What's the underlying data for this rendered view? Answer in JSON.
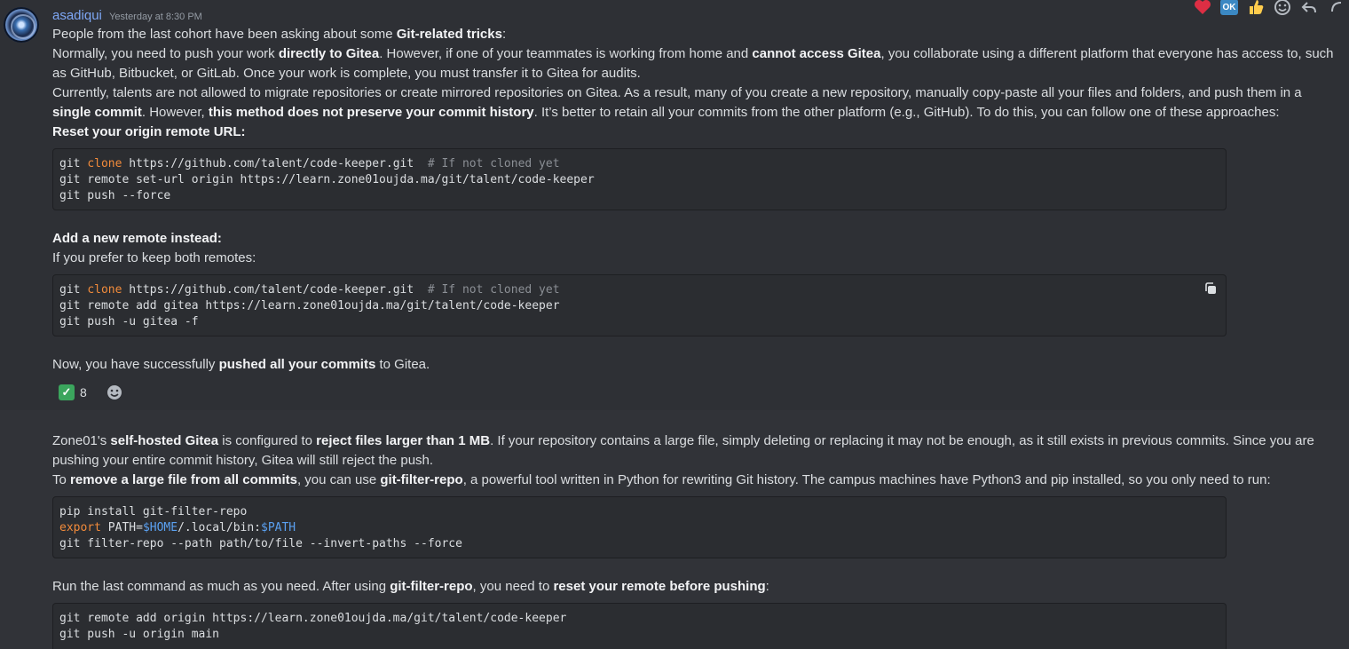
{
  "message1": {
    "username": "asadiqui",
    "timestamp": "Yesterday at 8:30 PM",
    "line1": {
      "a": "People from the last cohort have been asking about some ",
      "b": "Git-related tricks",
      "c": ":"
    },
    "line2": {
      "a": "Normally, you need to push your work ",
      "b": "directly to Gitea",
      "c": ". However, if one of your teammates is working from home and ",
      "d": "cannot access Gitea",
      "e": ", you collaborate using a different platform that everyone has access to, such"
    },
    "line3": "as GitHub, Bitbucket, or GitLab. Once your work is complete, you must transfer it to Gitea for audits.",
    "line4": "Currently, talents are not allowed to migrate repositories or create mirrored repositories on Gitea. As a result, many of you create a new repository, manually copy-paste all your files and folders, and push them in a",
    "line5": {
      "a": "single commit",
      "b": ". However, ",
      "c": "this method does not preserve your commit history",
      "d": ". It’s better to retain all your commits from the other platform (e.g., GitHub). To do this, you can follow one of these approaches:"
    },
    "heading1": "Reset your origin remote URL:",
    "code1": {
      "l1_git": "git ",
      "l1_kw": "clone",
      "l1_rest": " https://github.com/talent/code-keeper.git  ",
      "l1_cmt": "# If not cloned yet",
      "l2": "git remote set-url origin https://learn.zone01oujda.ma/git/talent/code-keeper",
      "l3": "git push --force"
    },
    "heading2": "Add a new remote instead:",
    "line6": "If you prefer to keep both remotes:",
    "code2": {
      "l1_git": "git ",
      "l1_kw": "clone",
      "l1_rest": " https://github.com/talent/code-keeper.git  ",
      "l1_cmt": "# If not cloned yet",
      "l2": "git remote add gitea https://learn.zone01oujda.ma/git/talent/code-keeper",
      "l3": "git push -u gitea -f"
    },
    "line7": {
      "a": "Now, you have successfully ",
      "b": "pushed all your commits",
      "c": " to Gitea."
    },
    "reaction": {
      "emoji": "check-mark",
      "count": "8"
    }
  },
  "message2": {
    "line1": {
      "a": "Zone01's ",
      "b": "self-hosted Gitea",
      "c": " is configured to ",
      "d": "reject files larger than 1 MB",
      "e": ". If your repository contains a large file, simply deleting or replacing it may not be enough, as it still exists in previous commits. Since you are"
    },
    "line2": "pushing your entire commit history, Gitea will still reject the push.",
    "line3": {
      "a": "To ",
      "b": "remove a large file from all commits",
      "c": ", you can use ",
      "d": "git-filter-repo",
      "e": ", a powerful tool written in Python for rewriting Git history. The campus machines have Python3 and pip installed, so you only need to run:"
    },
    "code3": {
      "l1": "pip install git-filter-repo",
      "l2_kw": "export",
      "l2_a": " PATH=",
      "l2_var1": "$HOME",
      "l2_b": "/.local/bin:",
      "l2_var2": "$PATH",
      "l3": "git filter-repo --path path/to/file --invert-paths --force"
    },
    "line4": {
      "a": "Run the last command as much as you need. After using ",
      "b": "git-filter-repo",
      "c": ", you need to ",
      "d": "reset your remote before pushing",
      "e": ":"
    },
    "code4": {
      "l1": "git remote add origin https://learn.zone01oujda.ma/git/talent/code-keeper",
      "l2": "git push -u origin main"
    }
  },
  "toolbar": {
    "icons": [
      "heart-icon",
      "ok-icon",
      "thumbs-up-icon",
      "add-reaction-icon",
      "reply-icon",
      "more-icon"
    ],
    "ok_label": "OK"
  },
  "colors": {
    "background": "#313338",
    "username": "#7ea7f5",
    "keyword": "#f28b3b",
    "variable": "#5aa0f0",
    "comment": "#8b8f95"
  }
}
